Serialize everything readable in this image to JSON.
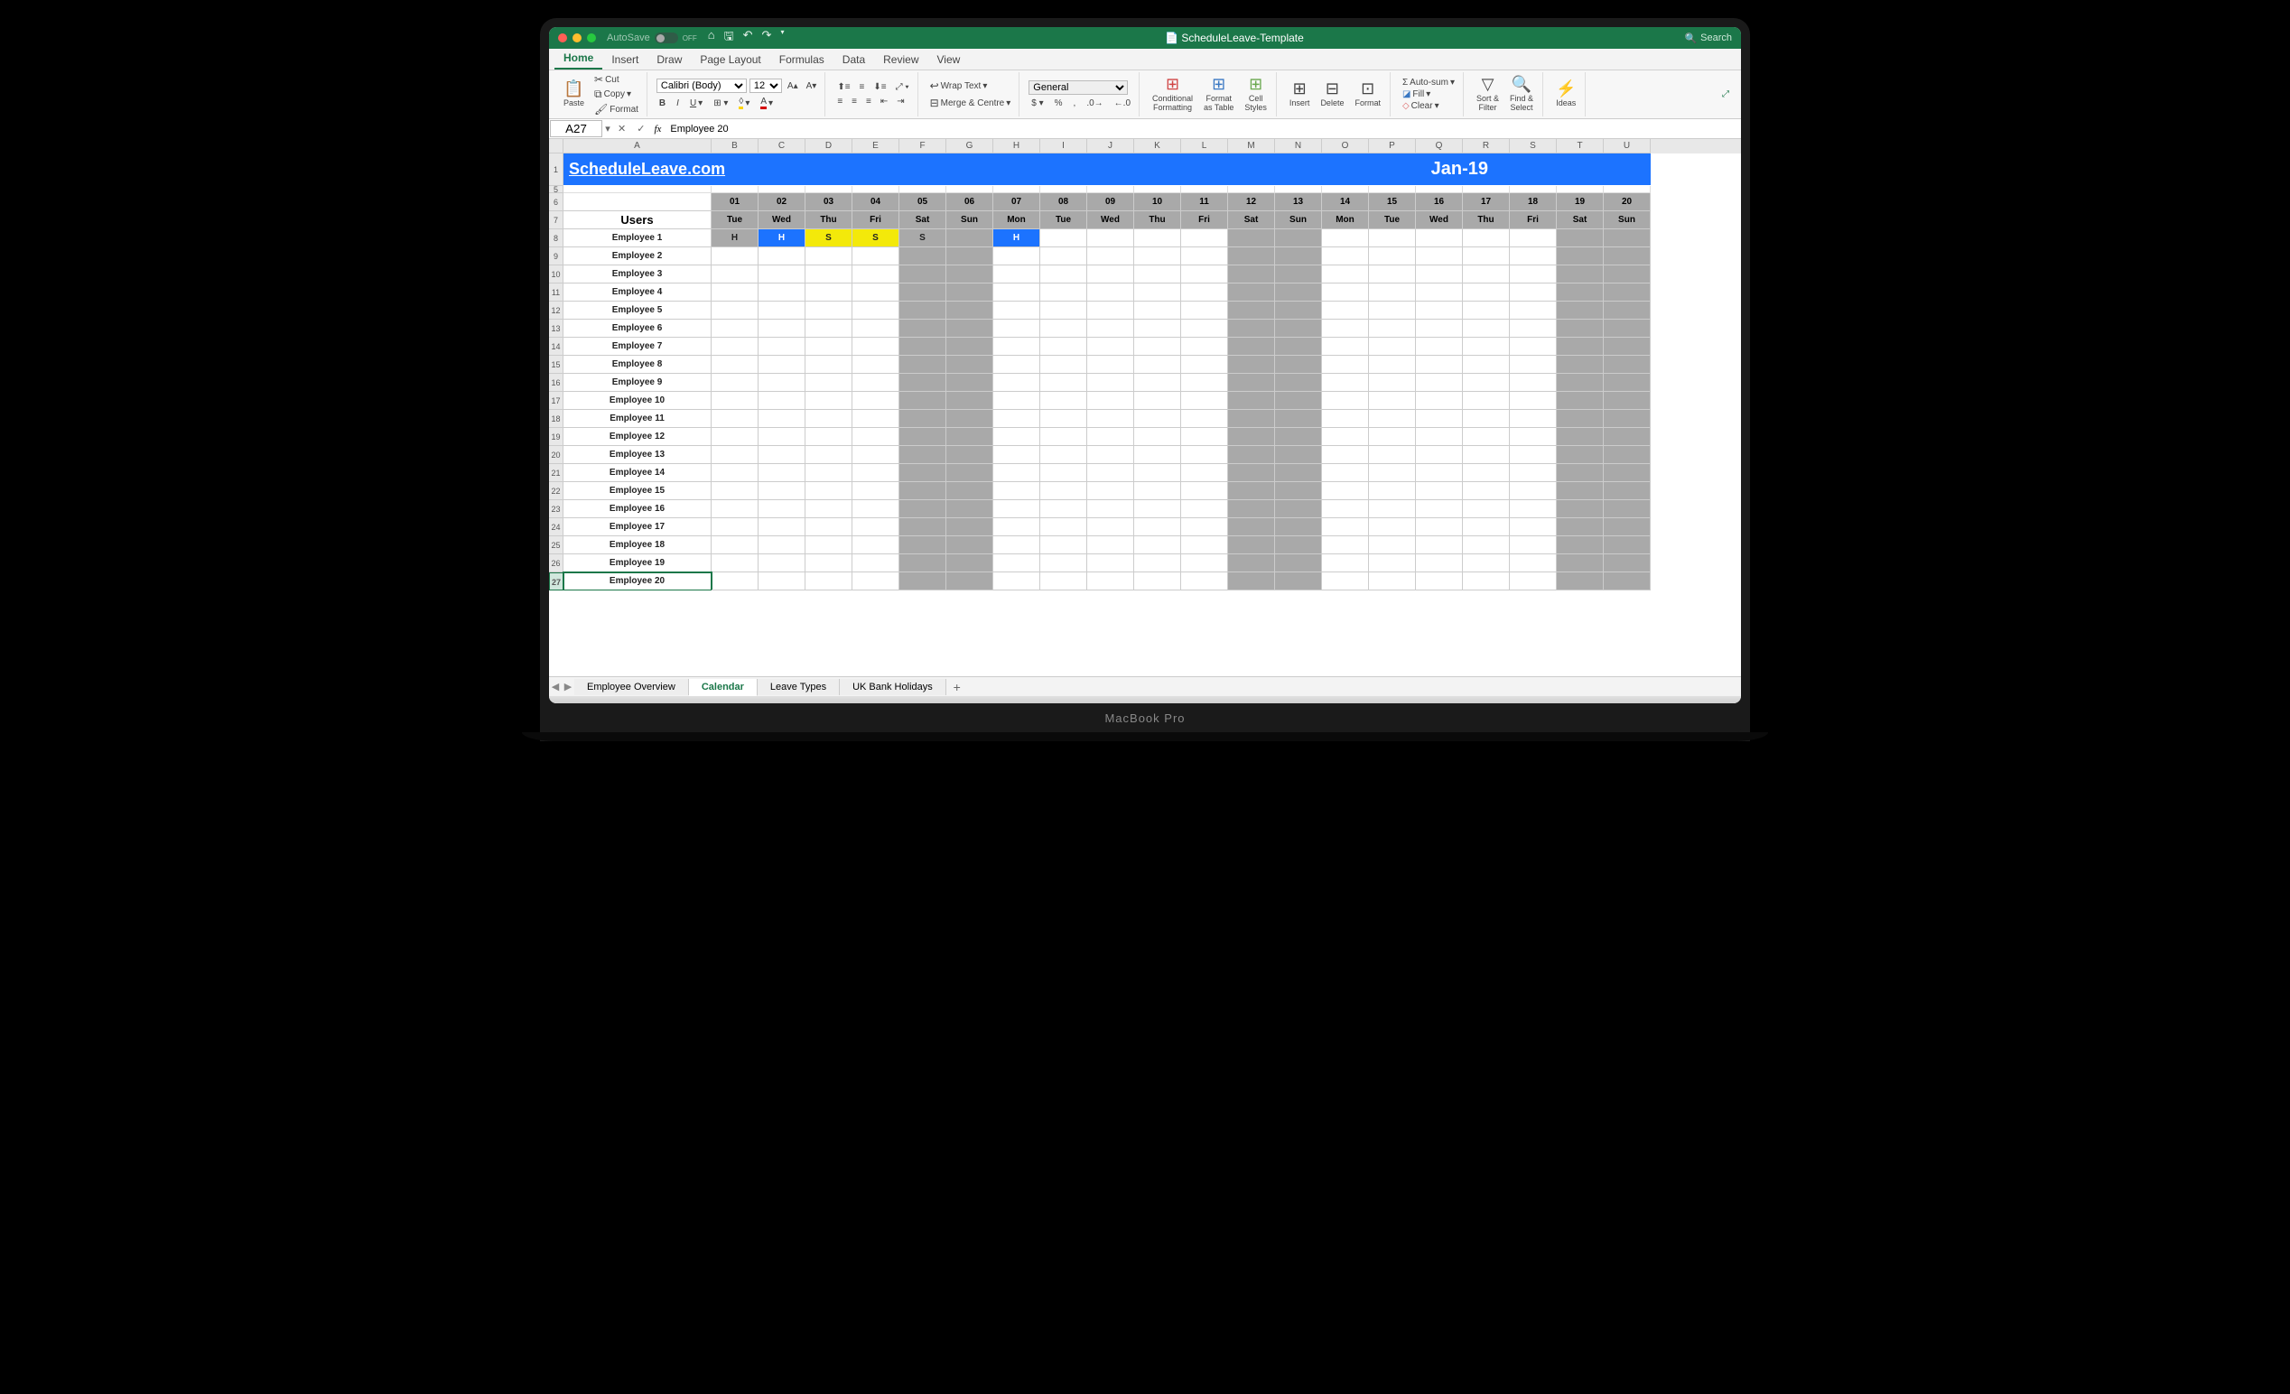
{
  "title": {
    "autosave": "AutoSave",
    "autosave_state": "OFF",
    "document": "ScheduleLeave-Template",
    "search": "Search"
  },
  "menu_tabs": [
    "Home",
    "Insert",
    "Draw",
    "Page Layout",
    "Formulas",
    "Data",
    "Review",
    "View"
  ],
  "ribbon": {
    "paste": "Paste",
    "cut": "Cut",
    "copy": "Copy",
    "format": "Format",
    "font_name": "Calibri (Body)",
    "font_size": "12",
    "wrap": "Wrap Text",
    "merge": "Merge & Centre",
    "number_format": "General",
    "cond_fmt": "Conditional\nFormatting",
    "fmt_table": "Format\nas Table",
    "cell_styles": "Cell\nStyles",
    "insert": "Insert",
    "delete": "Delete",
    "format2": "Format",
    "autosum": "Auto-sum",
    "fill": "Fill",
    "clear": "Clear",
    "sort": "Sort &\nFilter",
    "find": "Find &\nSelect",
    "ideas": "Ideas"
  },
  "namebox": "A27",
  "formula": "Employee 20",
  "columns": [
    "A",
    "B",
    "C",
    "D",
    "E",
    "F",
    "G",
    "H",
    "I",
    "J",
    "K",
    "L",
    "M",
    "N",
    "O",
    "P",
    "Q",
    "R",
    "S",
    "T",
    "U"
  ],
  "banner": {
    "site": "ScheduleLeave.com",
    "month": "Jan-19"
  },
  "days": {
    "nums": [
      "01",
      "02",
      "03",
      "04",
      "05",
      "06",
      "07",
      "08",
      "09",
      "10",
      "11",
      "12",
      "13",
      "14",
      "15",
      "16",
      "17",
      "18",
      "19",
      "20"
    ],
    "dows": [
      "Tue",
      "Wed",
      "Thu",
      "Fri",
      "Sat",
      "Sun",
      "Mon",
      "Tue",
      "Wed",
      "Thu",
      "Fri",
      "Sat",
      "Sun",
      "Mon",
      "Tue",
      "Wed",
      "Thu",
      "Fri",
      "Sat",
      "Sun"
    ],
    "weekend": [
      false,
      false,
      false,
      false,
      true,
      true,
      false,
      false,
      false,
      false,
      false,
      true,
      true,
      false,
      false,
      false,
      false,
      false,
      true,
      true
    ]
  },
  "users_header": "Users",
  "employees": [
    "Employee 1",
    "Employee 2",
    "Employee 3",
    "Employee 4",
    "Employee 5",
    "Employee 6",
    "Employee 7",
    "Employee 8",
    "Employee 9",
    "Employee 10",
    "Employee 11",
    "Employee 12",
    "Employee 13",
    "Employee 14",
    "Employee 15",
    "Employee 16",
    "Employee 17",
    "Employee 18",
    "Employee 19",
    "Employee 20"
  ],
  "emp1_marks": {
    "0": {
      "v": "H",
      "cls": "hol-gray"
    },
    "1": {
      "v": "H",
      "cls": "hol-blue"
    },
    "2": {
      "v": "S",
      "cls": "hol-yel"
    },
    "3": {
      "v": "S",
      "cls": "hol-yel"
    },
    "4": {
      "v": "S",
      "cls": "hol-gray"
    },
    "6": {
      "v": "H",
      "cls": "hol-blue"
    }
  },
  "row_nums": [
    "1",
    "5",
    "6",
    "7",
    "8",
    "9",
    "10",
    "11",
    "12",
    "13",
    "14",
    "15",
    "16",
    "17",
    "18",
    "19",
    "20",
    "21",
    "22",
    "23",
    "24",
    "25",
    "26",
    "27"
  ],
  "sheet_tabs": [
    "Employee Overview",
    "Calendar",
    "Leave Types",
    "UK Bank Holidays"
  ],
  "active_sheet": 1,
  "laptop": "MacBook Pro"
}
